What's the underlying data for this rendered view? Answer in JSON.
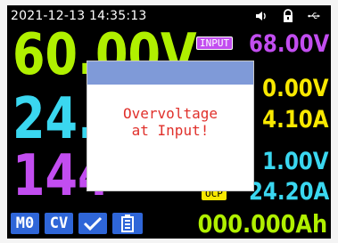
{
  "status": {
    "datetime": "2021-12-13 14:35:13",
    "icons": [
      "speaker-icon",
      "lock-icon",
      "usb-icon"
    ]
  },
  "readouts": {
    "voltage": "60.00V",
    "current": "24.",
    "power": "144"
  },
  "right_panel": {
    "input_label": "INPUT",
    "input_voltage": "68.00V",
    "set_voltage": "0.00V",
    "set_current": "4.10A",
    "ovp": "1.00V",
    "ocp_label": "OCP",
    "ocp": "24.20A"
  },
  "bottom_bar": {
    "memory": "M0",
    "mode": "CV",
    "energy": "000.000Ah"
  },
  "dialog": {
    "message": "Overvoltage\nat Input!"
  },
  "colors": {
    "voltage": "#b0f000",
    "current": "#3ad7f0",
    "power": "#c24df0",
    "setpoints": "#f8e800",
    "chip_blue": "#2f66d8",
    "dialog_title": "#7f9ad8",
    "dialog_text": "#e0302b"
  }
}
